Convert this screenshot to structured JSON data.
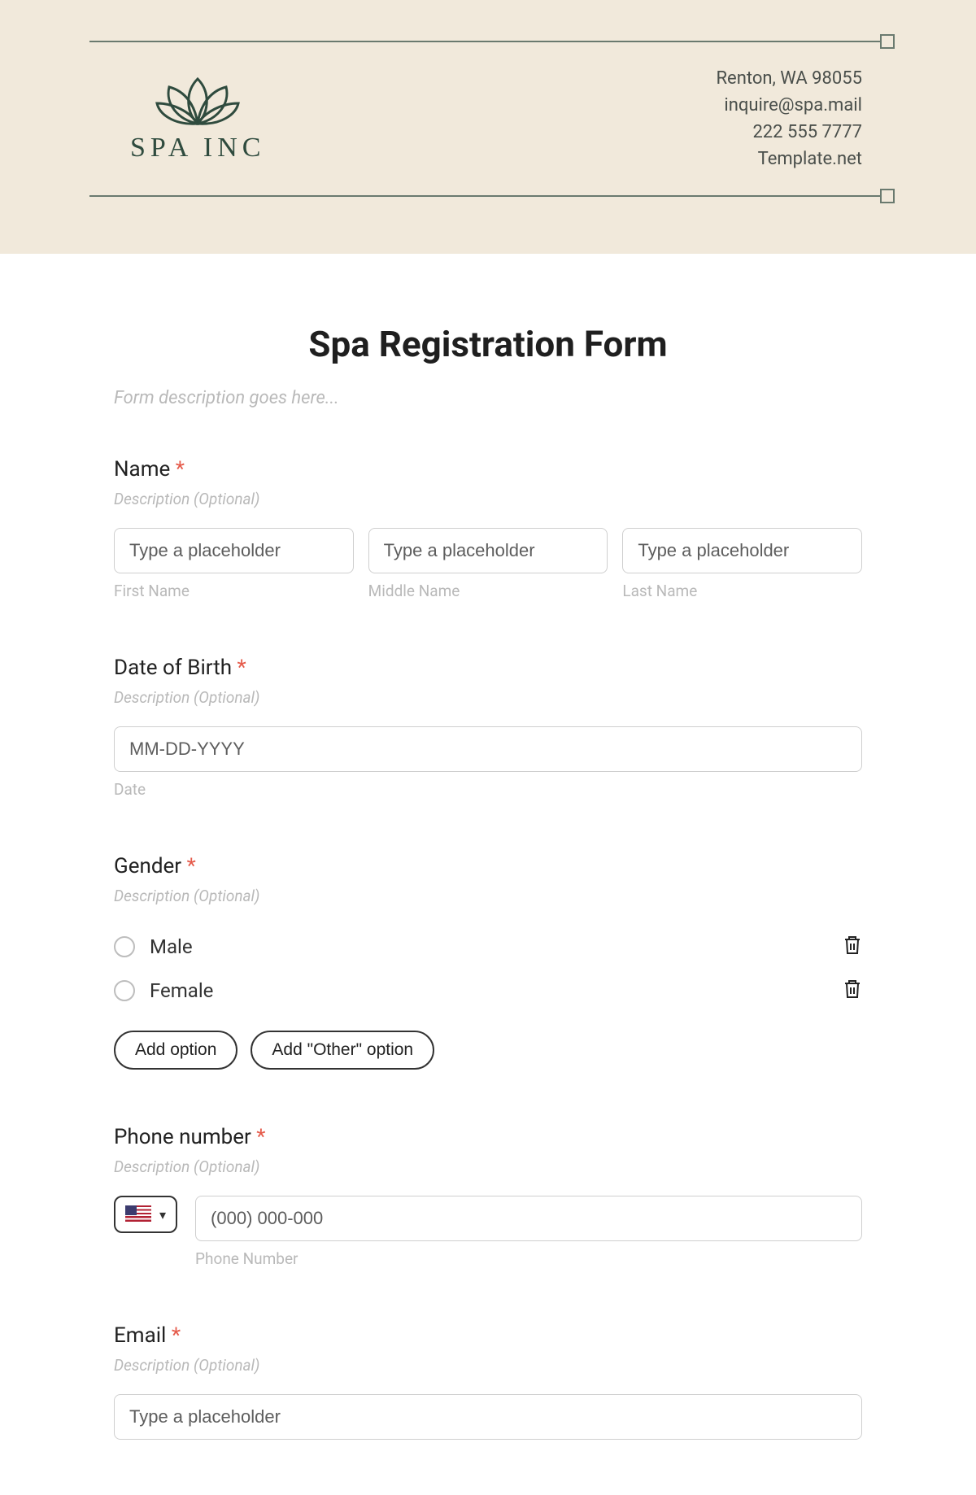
{
  "header": {
    "brand": "SPA INC",
    "contact": {
      "address": "Renton, WA 98055",
      "email": "inquire@spa.mail",
      "phone": "222 555 7777",
      "site": "Template.net"
    }
  },
  "form": {
    "title": "Spa Registration Form",
    "description_placeholder": "Form description goes here...",
    "name": {
      "label": "Name",
      "desc": "Description (Optional)",
      "first": {
        "placeholder": "Type a placeholder",
        "sub": "First Name"
      },
      "middle": {
        "placeholder": "Type a placeholder",
        "sub": "Middle Name"
      },
      "last": {
        "placeholder": "Type a placeholder",
        "sub": "Last Name"
      }
    },
    "dob": {
      "label": "Date of Birth",
      "desc": "Description (Optional)",
      "placeholder": "MM-DD-YYYY",
      "sub": "Date"
    },
    "gender": {
      "label": "Gender",
      "desc": "Description (Optional)",
      "options": [
        "Male",
        "Female"
      ],
      "add_option": "Add option",
      "add_other": "Add \"Other\" option"
    },
    "phone": {
      "label": "Phone number",
      "desc": "Description (Optional)",
      "placeholder": "(000) 000-000",
      "sub": "Phone Number"
    },
    "email": {
      "label": "Email",
      "desc": "Description (Optional)",
      "placeholder": "Type a placeholder"
    }
  }
}
